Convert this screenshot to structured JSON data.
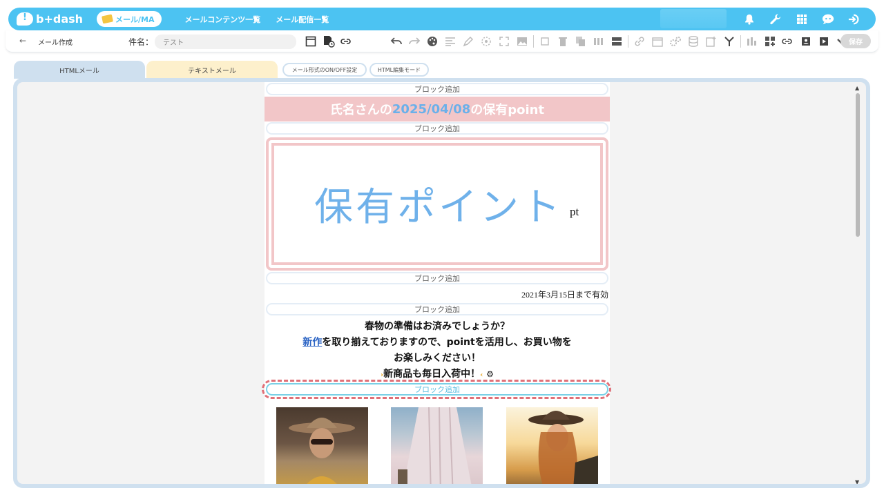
{
  "nav": {
    "logo_text": "b+dash",
    "module_label": "メール/MA",
    "links": [
      "メールコンテンツ一覧",
      "メール配信一覧"
    ]
  },
  "toolbar": {
    "back_icon": "←",
    "breadcrumb": "メール作成",
    "subject_label": "件名：",
    "subject_value": "テスト",
    "save_label": "保存"
  },
  "tabs": {
    "html": "HTMLメール",
    "text": "テキストメール",
    "toggle": "メール形式のON/OFF設定",
    "html_edit": "HTML編集モード"
  },
  "editor": {
    "add_block_label": "ブロック追加",
    "banner_prefix": "氏名さんの",
    "banner_date": "2025/04/08",
    "banner_suffix": "の保有point",
    "point_text": "保有ポイント",
    "point_unit": "pt",
    "expire_text": "2021年3月15日まで有効",
    "message_line1": "春物の準備はお済みでしょうか？",
    "message_link": "新作",
    "message_line2_rest": "を取り揃えておりますので、pointを活用し、お買い物を",
    "message_line3": "お楽しみください！",
    "message_line4": "新商品も毎日入荷中！"
  },
  "colors": {
    "nav_blue": "#4cc3f2",
    "pink": "#f2c6c8",
    "point_blue": "#6fb1ea",
    "highlight_red": "#e07078"
  }
}
